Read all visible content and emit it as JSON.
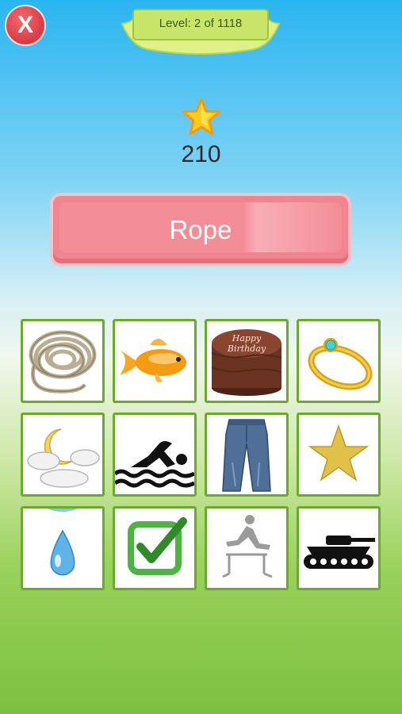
{
  "header": {
    "close_label": "X",
    "level_label": "Level: 2 of 1118"
  },
  "score": {
    "value": "210",
    "icon": "star-icon"
  },
  "target_word": "Rope",
  "choices": [
    {
      "name": "rope",
      "icon": "rope-icon"
    },
    {
      "name": "goldfish",
      "icon": "goldfish-icon"
    },
    {
      "name": "birthday-cake",
      "icon": "birthday-cake-icon",
      "text": "Happy Birthday"
    },
    {
      "name": "ring",
      "icon": "ring-icon"
    },
    {
      "name": "moon-clouds",
      "icon": "moon-clouds-icon"
    },
    {
      "name": "swimmer",
      "icon": "swimmer-icon"
    },
    {
      "name": "jeans",
      "icon": "jeans-icon"
    },
    {
      "name": "star",
      "icon": "star-icon"
    },
    {
      "name": "water-drop",
      "icon": "water-drop-icon"
    },
    {
      "name": "checkmark",
      "icon": "checkmark-icon"
    },
    {
      "name": "hurdler",
      "icon": "hurdler-icon"
    },
    {
      "name": "tank",
      "icon": "tank-icon"
    }
  ],
  "colors": {
    "tile_border": "#6caa2d",
    "word_button": "#f0848f",
    "close_button": "#d93a44"
  }
}
